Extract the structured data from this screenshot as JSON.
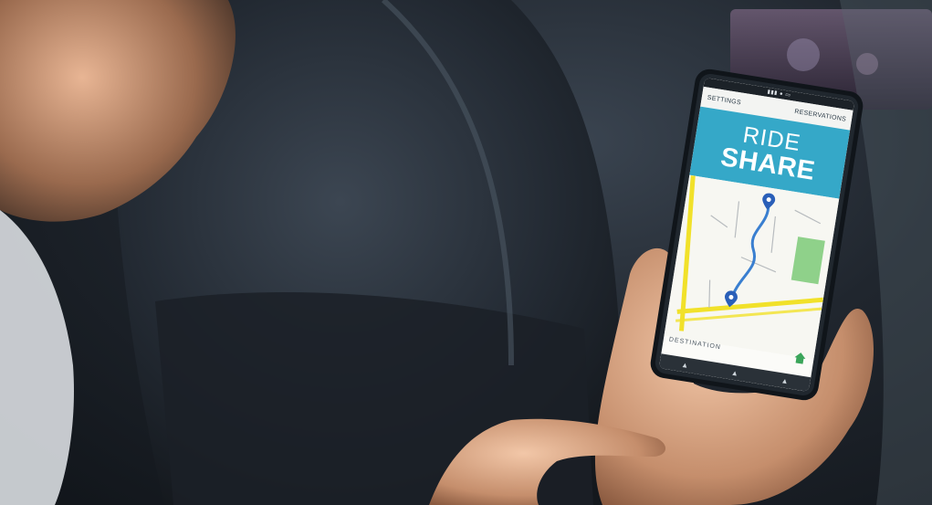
{
  "app": {
    "nav_left": "SETTINGS",
    "nav_right": "RESERVATIONS",
    "banner_line1": "RIDE",
    "banner_line2": "SHARE",
    "destination_label": "DESTINATION"
  },
  "colors": {
    "banner": "#35a8c8",
    "route": "#3a7fd0",
    "roads": "#f1e12a",
    "park": "#8fd18a",
    "home_icon": "#3aa55a"
  },
  "icons": [
    "pin-icon",
    "home-icon",
    "nav-triangle-icon"
  ]
}
